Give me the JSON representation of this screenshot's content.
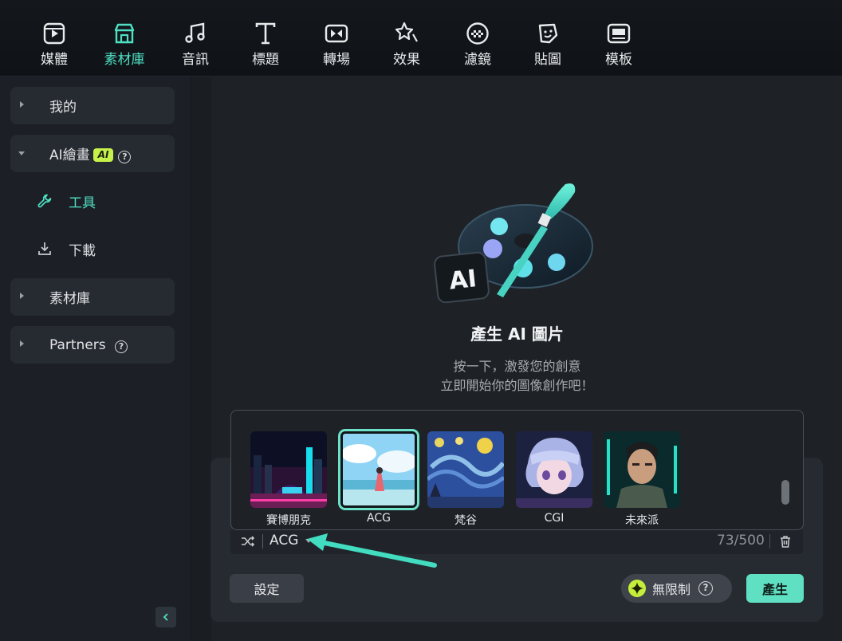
{
  "toolbar": {
    "items": [
      {
        "label": "媒體",
        "icon": "media-icon"
      },
      {
        "label": "素材庫",
        "icon": "stock-icon"
      },
      {
        "label": "音訊",
        "icon": "music-icon"
      },
      {
        "label": "標題",
        "icon": "title-icon"
      },
      {
        "label": "轉場",
        "icon": "transition-icon"
      },
      {
        "label": "效果",
        "icon": "effects-icon"
      },
      {
        "label": "濾鏡",
        "icon": "filter-icon"
      },
      {
        "label": "貼圖",
        "icon": "sticker-icon"
      },
      {
        "label": "模板",
        "icon": "template-icon"
      }
    ],
    "active": "素材庫",
    "accent": "#4fe0c3"
  },
  "sidebar": {
    "items": [
      {
        "label": "我的"
      },
      {
        "label": "AI繪畫",
        "badge": "AI"
      },
      {
        "label": "素材庫"
      },
      {
        "label": "Partners"
      }
    ],
    "subitems": [
      {
        "label": "工具",
        "active": true
      },
      {
        "label": "下載"
      }
    ]
  },
  "main": {
    "hero_badge": "AI",
    "title": "產生 AI 圖片",
    "desc_line1": "按一下，激發您的創意",
    "desc_line2": "立即開始你的圖像創作吧！",
    "styles": [
      {
        "label": "賽博朋克"
      },
      {
        "label": "ACG",
        "selected": true
      },
      {
        "label": "梵谷"
      },
      {
        "label": "CGI"
      },
      {
        "label": "未來派"
      }
    ],
    "prompt": {
      "style_value": "ACG",
      "counter": "73/500"
    },
    "buttons": {
      "settings": "設定",
      "unlimited": "無限制",
      "generate": "產生"
    }
  }
}
